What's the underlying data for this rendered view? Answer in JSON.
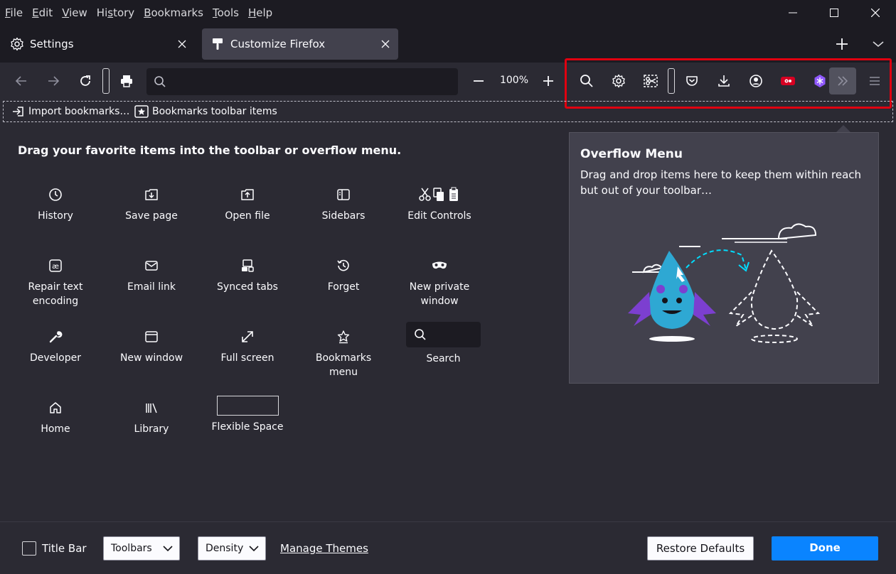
{
  "menubar": {
    "items": [
      {
        "first": "F",
        "rest": "ile"
      },
      {
        "first": "E",
        "rest": "dit"
      },
      {
        "first": "V",
        "rest": "iew"
      },
      {
        "first": "",
        "rest": "History",
        "pre": "Hi",
        "ul": "s",
        "post": "tory"
      },
      {
        "first": "B",
        "rest": "ookmarks"
      },
      {
        "first": "T",
        "rest": "ools"
      },
      {
        "first": "H",
        "rest": "elp"
      }
    ]
  },
  "tabs": [
    {
      "label": "Settings",
      "icon": "gear-icon",
      "active": false
    },
    {
      "label": "Customize Firefox",
      "icon": "customize-icon",
      "active": true
    }
  ],
  "navbar": {
    "zoom": "100%",
    "url_value": "",
    "overflow_icons": [
      "search-icon",
      "gear-icon",
      "screenshot-icon",
      "flexible-spacer",
      "pocket-icon",
      "download-icon",
      "account-icon",
      "extension-red-icon",
      "extension-purple-icon",
      "overflow-chevron-icon",
      "hamburger-menu-icon"
    ]
  },
  "bookmarks": {
    "import_label": "Import bookmarks…",
    "toolbar_items_label": "Bookmarks toolbar items"
  },
  "palette": {
    "heading": "Drag your favorite items into the toolbar or overflow menu.",
    "items": {
      "history": "History",
      "save_page": "Save page",
      "open_file": "Open file",
      "sidebars": "Sidebars",
      "edit_controls": "Edit Controls",
      "repair_text_1": "Repair text",
      "repair_text_2": "encoding",
      "email_link": "Email link",
      "synced_tabs": "Synced tabs",
      "forget": "Forget",
      "new_private_1": "New private",
      "new_private_2": "window",
      "developer": "Developer",
      "new_window": "New window",
      "full_screen": "Full screen",
      "bookmarks_menu_1": "Bookmarks",
      "bookmarks_menu_2": "menu",
      "search": "Search",
      "home": "Home",
      "library": "Library",
      "flexible_space": "Flexible Space"
    }
  },
  "overflow": {
    "title": "Overflow Menu",
    "description": "Drag and drop items here to keep them within reach but out of your toolbar…"
  },
  "footer": {
    "title_bar_label": "Title Bar",
    "toolbars_label": "Toolbars",
    "density_label": "Density",
    "manage_themes": "Manage Themes",
    "restore_defaults": "Restore Defaults",
    "done": "Done"
  },
  "colors": {
    "chrome_dark": "#1c1b22",
    "content_bg": "#2b2a33",
    "panel_bg": "#42414d",
    "accent_blue": "#0a84ff",
    "highlight_red": "#e00010"
  }
}
